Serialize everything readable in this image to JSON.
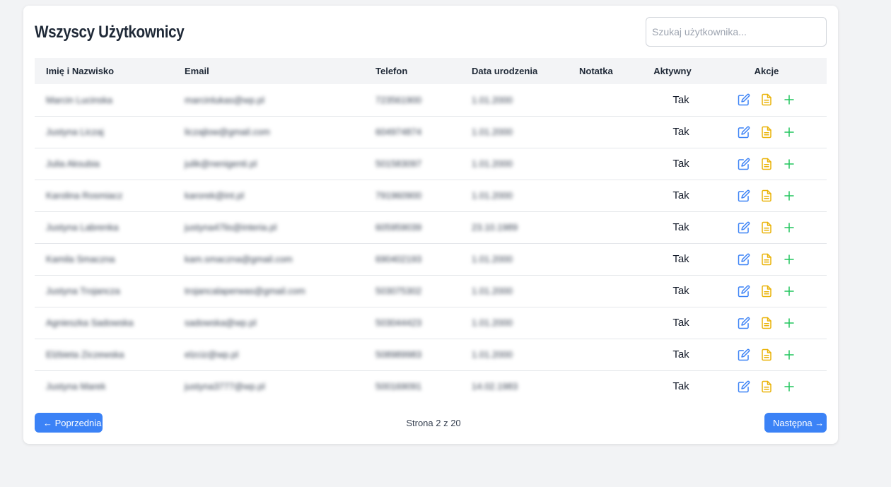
{
  "page": {
    "title": "Wszyscy Użytkownicy",
    "search_placeholder": "Szukaj użytkownika..."
  },
  "table": {
    "columns": [
      "Imię i Nazwisko",
      "Email",
      "Telefon",
      "Data urodzenia",
      "Notatka",
      "Aktywny",
      "Akcje"
    ],
    "rows": [
      {
        "name": "Marcin Lucinska",
        "email": "marcinlukas@wp.pl",
        "phone": "723561900",
        "birth": "1.01.2000",
        "note": "",
        "active": "Tak"
      },
      {
        "name": "Justyna Liczaj",
        "email": "liczajlow@gmail.com",
        "phone": "604974874",
        "birth": "1.01.2000",
        "note": "",
        "active": "Tak"
      },
      {
        "name": "Julia Aksubia",
        "email": "julik@nenigenti.pl",
        "phone": "501583097",
        "birth": "1.01.2000",
        "note": "",
        "active": "Tak"
      },
      {
        "name": "Karolina Rosmiacz",
        "email": "karorek@int.pl",
        "phone": "791960900",
        "birth": "1.01.2000",
        "note": "",
        "active": "Tak"
      },
      {
        "name": "Justyna Labrenka",
        "email": "justyna47lis@interia.pl",
        "phone": "605959039",
        "birth": "23.10.1989",
        "note": "",
        "active": "Tak"
      },
      {
        "name": "Kamila Smaczna",
        "email": "kam.smaczna@gmail.com",
        "phone": "690402193",
        "birth": "1.01.2000",
        "note": "",
        "active": "Tak"
      },
      {
        "name": "Justyna Trojancza",
        "email": "trojancalaperwas@gmail.com",
        "phone": "503075302",
        "birth": "1.01.2000",
        "note": "",
        "active": "Tak"
      },
      {
        "name": "Agnieszka Sadowska",
        "email": "sadowska@wp.pl",
        "phone": "503044423",
        "birth": "1.01.2000",
        "note": "",
        "active": "Tak"
      },
      {
        "name": "Elżbieta Ziczewska",
        "email": "elzciz@wp.pl",
        "phone": "508989983",
        "birth": "1.01.2000",
        "note": "",
        "active": "Tak"
      },
      {
        "name": "Justyna Marek",
        "email": "justyna3777@wp.pl",
        "phone": "500169091",
        "birth": "14.02.1983",
        "note": "",
        "active": "Tak"
      }
    ]
  },
  "pagination": {
    "prev_label": "← Poprzednia",
    "next_label": "Następna →",
    "page_info": "Strona 2 z 20"
  },
  "icons": {
    "edit": "edit-icon",
    "note": "document-icon",
    "add": "plus-icon"
  },
  "colors": {
    "accent": "#3b82f6",
    "edit_icon": "#3b82f6",
    "note_icon": "#eab308",
    "add_icon": "#22c55e"
  }
}
